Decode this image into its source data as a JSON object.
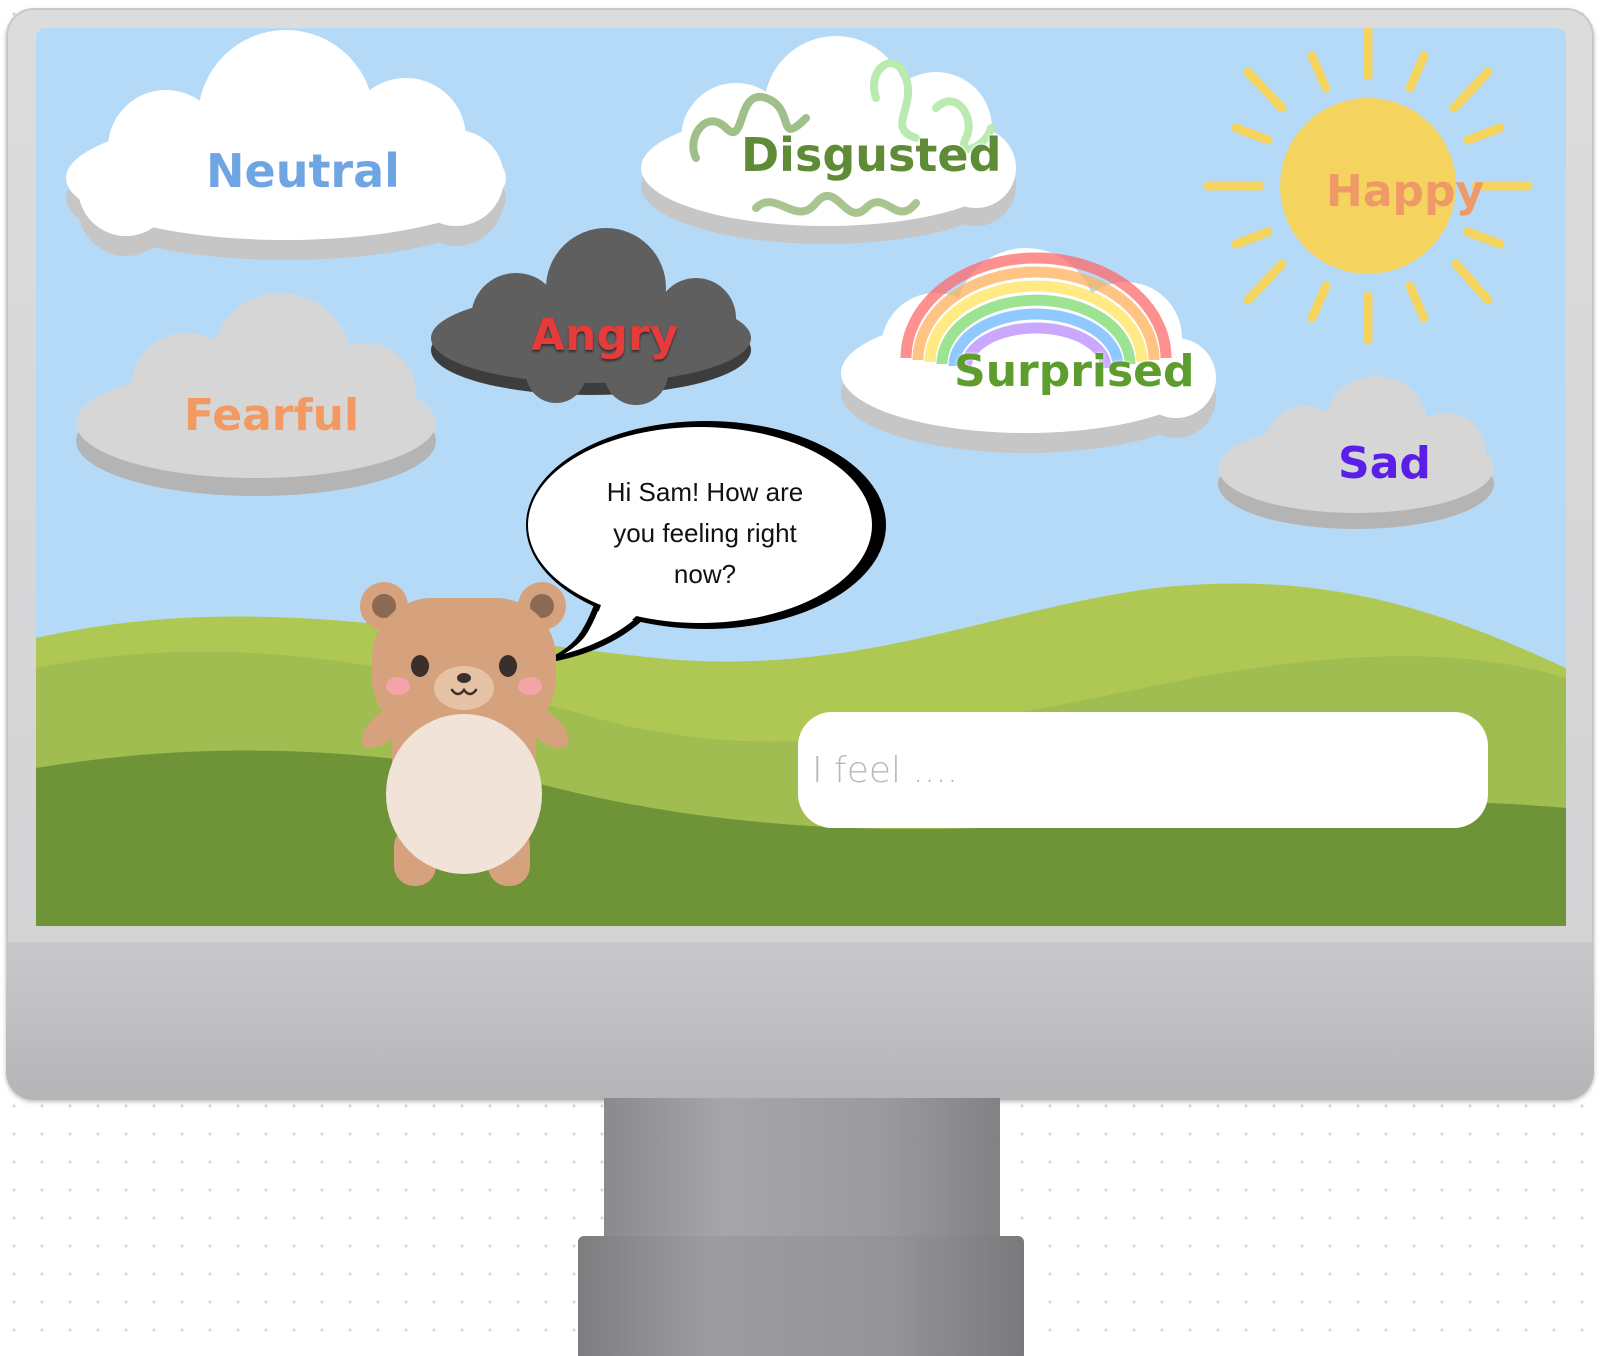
{
  "screen": {
    "emotions": [
      {
        "id": "neutral",
        "label": "Neutral",
        "color": "#6fa5e2"
      },
      {
        "id": "disgusted",
        "label": "Disgusted",
        "color": "#5f8b36"
      },
      {
        "id": "happy",
        "label": "Happy",
        "color": "#ef9a66"
      },
      {
        "id": "angry",
        "label": "Angry",
        "color": "#e53b3b"
      },
      {
        "id": "surprised",
        "label": "Surprised",
        "color": "#5d9d2d"
      },
      {
        "id": "fearful",
        "label": "Fearful",
        "color": "#f39a63"
      },
      {
        "id": "sad",
        "label": "Sad",
        "color": "#5b1ee8"
      }
    ],
    "speech_bubble": {
      "line1": "Hi Sam! How are",
      "line2": "you feeling right",
      "line3": "now?"
    },
    "feel_input": {
      "placeholder": "I feel ....",
      "value": ""
    },
    "colors": {
      "sky": "#b5daf7",
      "hill_light": "#aec853",
      "hill_mid": "#9fbd50",
      "hill_dark": "#6f9438",
      "sun": "#f5d35f",
      "storm_cloud": "#5f5f5f",
      "bear": "#d6a27e"
    }
  }
}
